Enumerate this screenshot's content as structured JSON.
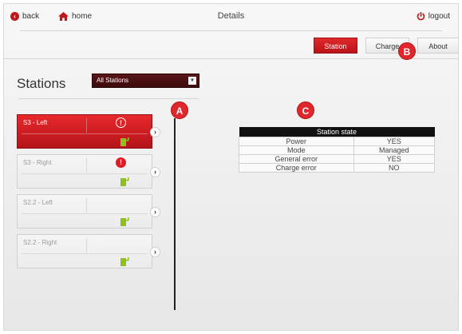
{
  "topbar": {
    "back_label": "back",
    "home_label": "home",
    "page_title": "Details",
    "logout_label": "logout"
  },
  "tabs": [
    {
      "label": "Station",
      "active": true
    },
    {
      "label": "Charge",
      "active": false
    },
    {
      "label": "About",
      "active": false
    }
  ],
  "stations_panel": {
    "title": "Stations",
    "filter_value": "All Stations"
  },
  "stations": [
    {
      "name": "S3 - Left",
      "selected": true,
      "alert": "outline"
    },
    {
      "name": "S3 - Right",
      "selected": false,
      "alert": "solid"
    },
    {
      "name": "S2.2 - Left",
      "selected": false,
      "alert": "none"
    },
    {
      "name": "S2.2 - Right",
      "selected": false,
      "alert": "none"
    }
  ],
  "station_state": {
    "header": "Station state",
    "rows": [
      {
        "label": "Power",
        "value": "YES"
      },
      {
        "label": "Mode",
        "value": "Managed"
      },
      {
        "label": "General error",
        "value": "YES"
      },
      {
        "label": "Charge error",
        "value": "NO"
      }
    ]
  },
  "annotations": [
    "A",
    "B",
    "C"
  ],
  "colors": {
    "accent_red": "#e0282c",
    "dark_red": "#3c0a0c",
    "plug_green": "#8ec11e"
  },
  "icons": {
    "back": "back-arrow-icon",
    "home": "home-icon",
    "logout": "power-icon",
    "alert": "exclamation-icon",
    "plug": "charging-plug-icon",
    "chevron": "chevron-right-icon"
  }
}
